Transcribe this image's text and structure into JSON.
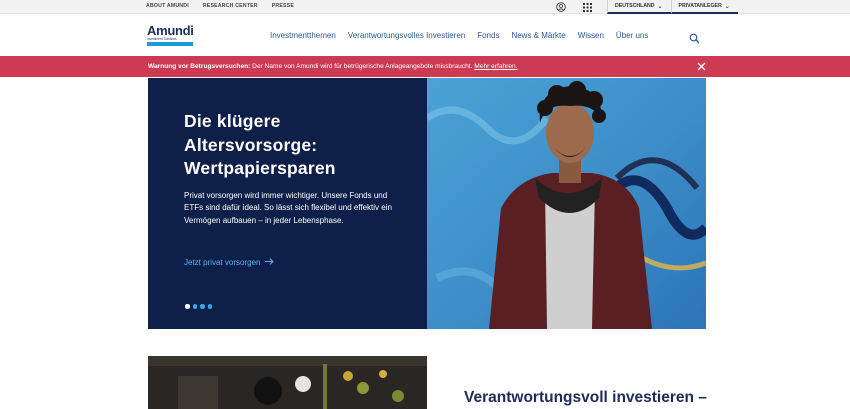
{
  "topbar": {
    "links": [
      "ABOUT AMUNDI",
      "RESEARCH CENTER",
      "PRESSE"
    ],
    "icons": [
      "account-icon",
      "apps-grid-icon"
    ],
    "country_select": "DEUTSCHLAND",
    "audience_select": "PRIVATANLEGER"
  },
  "header": {
    "logo_word": "Amundi",
    "logo_sub": "Investment Solutions",
    "nav": [
      "Investmentthemen",
      "Verantwortungsvolles Investieren",
      "Fonds",
      "News & Märkte",
      "Wissen",
      "Über uns"
    ],
    "search_icon": "search-icon"
  },
  "alert": {
    "label": "Warnung vor Betrugsversuchen:",
    "text": " Der Name von Amundi wird für betrügerische Anlageangebote missbraucht. ",
    "link": "Mehr erfahren.",
    "close_icon": "close-icon",
    "color": "#cc3b52"
  },
  "hero": {
    "title_lines": [
      "Die klügere",
      "Altersvorsorge:",
      "Wertpapiersparen"
    ],
    "text": "Privat vorsorgen wird immer wichtiger. Unsere Fonds und ETFs sind dafür ideal. So lässt sich flexibel und effektiv ein Vermögen aufbauen – in jeder Lebensphase.",
    "cta": "Jetzt privat vorsorgen",
    "slides": 4,
    "active_slide": 1,
    "bg_color": "#0e1f4a",
    "accent_color": "#2fa8e6"
  },
  "section": {
    "title": "Verantwortungsvoll investieren –"
  }
}
